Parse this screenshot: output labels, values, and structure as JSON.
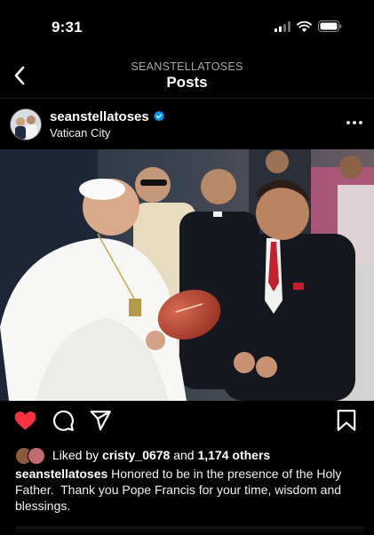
{
  "status": {
    "time": "9:31"
  },
  "nav": {
    "username": "SEANSTELLATOSES",
    "title": "Posts"
  },
  "post": {
    "username": "seanstellatoses",
    "location": "Vatican City"
  },
  "likes": {
    "prefix": "Liked by ",
    "user": "cristy_0678",
    "middle": " and ",
    "others": "1,174 others"
  },
  "caption": {
    "username": "seanstellatoses",
    "text": " Honored to be in the presence of the Holy Father.  Thank you Pope Francis for your time, wisdom and blessings."
  },
  "colors": {
    "like": "#ff3040",
    "verified": "#0095f6",
    "background": "#000000"
  },
  "icons": [
    "back-chevron-icon",
    "verified-badge-icon",
    "more-options-icon",
    "heart-icon",
    "comment-icon",
    "share-icon",
    "bookmark-icon",
    "signal-icon",
    "wifi-icon",
    "battery-icon"
  ]
}
